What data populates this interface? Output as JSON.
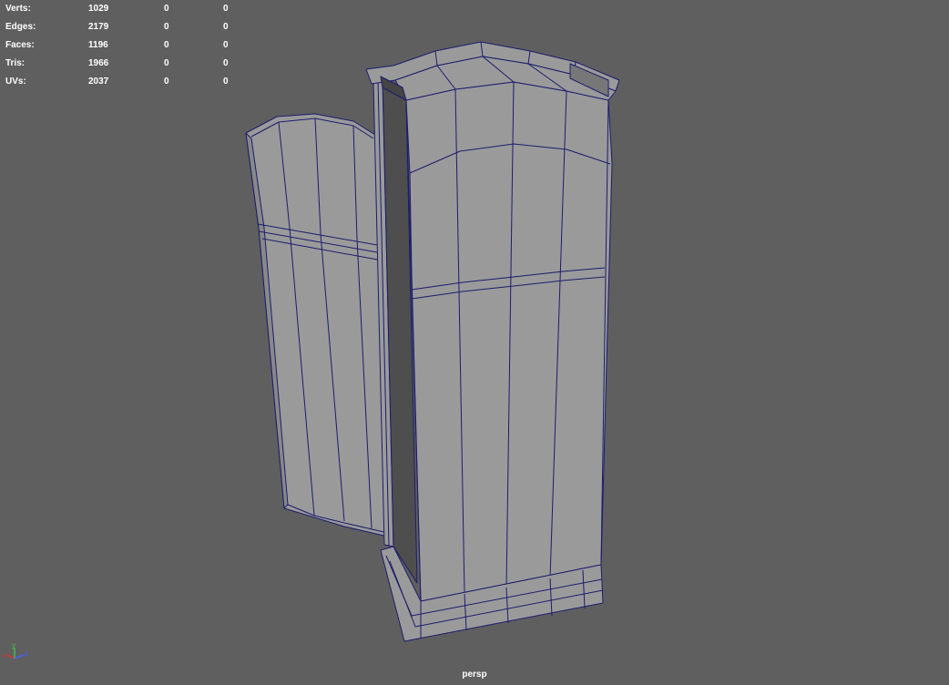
{
  "hud": {
    "rows": [
      {
        "label": "Verts:",
        "v1": "1029",
        "v2": "0",
        "v3": "0"
      },
      {
        "label": "Edges:",
        "v1": "2179",
        "v2": "0",
        "v3": "0"
      },
      {
        "label": "Faces:",
        "v1": "1196",
        "v2": "0",
        "v3": "0"
      },
      {
        "label": "Tris:",
        "v1": "1966",
        "v2": "0",
        "v3": "0"
      },
      {
        "label": "UVs:",
        "v1": "2037",
        "v2": "0",
        "v3": "0"
      }
    ]
  },
  "camera": {
    "name": "persp"
  },
  "axis": {
    "x_label": "x",
    "y_label": "y",
    "z_label": "z"
  },
  "colors": {
    "background": "#5f5f5f",
    "mesh_fill": "#9a9a9a",
    "mesh_shadow": "#5a5a5a",
    "wireframe": "#1c1c6e",
    "axis_x": "#e03030",
    "axis_y": "#40c040",
    "axis_z": "#4060ff"
  }
}
